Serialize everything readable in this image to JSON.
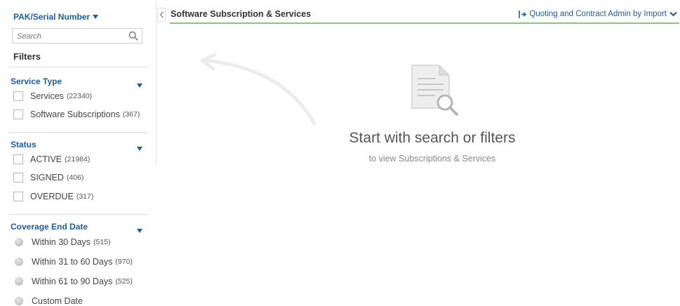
{
  "search": {
    "type_label": "PAK/Serial Number",
    "placeholder": "Search"
  },
  "filters": {
    "title": "Filters",
    "service_type": {
      "title": "Service Type",
      "options": [
        {
          "label": "Services",
          "count": "(22340)"
        },
        {
          "label": "Software Subscriptions",
          "count": "(367)"
        }
      ]
    },
    "status": {
      "title": "Status",
      "options": [
        {
          "label": "ACTIVE",
          "count": "(21984)"
        },
        {
          "label": "SIGNED",
          "count": "(406)"
        },
        {
          "label": "OVERDUE",
          "count": "(317)"
        }
      ]
    },
    "coverage_end_date": {
      "title": "Coverage End Date",
      "options": [
        {
          "label": "Within 30 Days",
          "count": "(515)"
        },
        {
          "label": "Within 31 to 60 Days",
          "count": "(970)"
        },
        {
          "label": "Within 61 to 90 Days",
          "count": "(525)"
        },
        {
          "label": "Custom Date",
          "count": ""
        }
      ]
    }
  },
  "header": {
    "title": "Software Subscription & Services",
    "import_label": "Quoting and Contract Admin by Import"
  },
  "empty_state": {
    "title": "Start with search or filters",
    "subtitle": "to view Subscriptions & Services"
  },
  "colors": {
    "link_blue": "#1c5d9c",
    "header_underline": "#8fc67a"
  },
  "icons": {
    "search": "magnifier",
    "dropdown": "triangle-down",
    "collapse": "chevron-left",
    "import": "sign-in-arrow",
    "empty_state": "document-search"
  }
}
